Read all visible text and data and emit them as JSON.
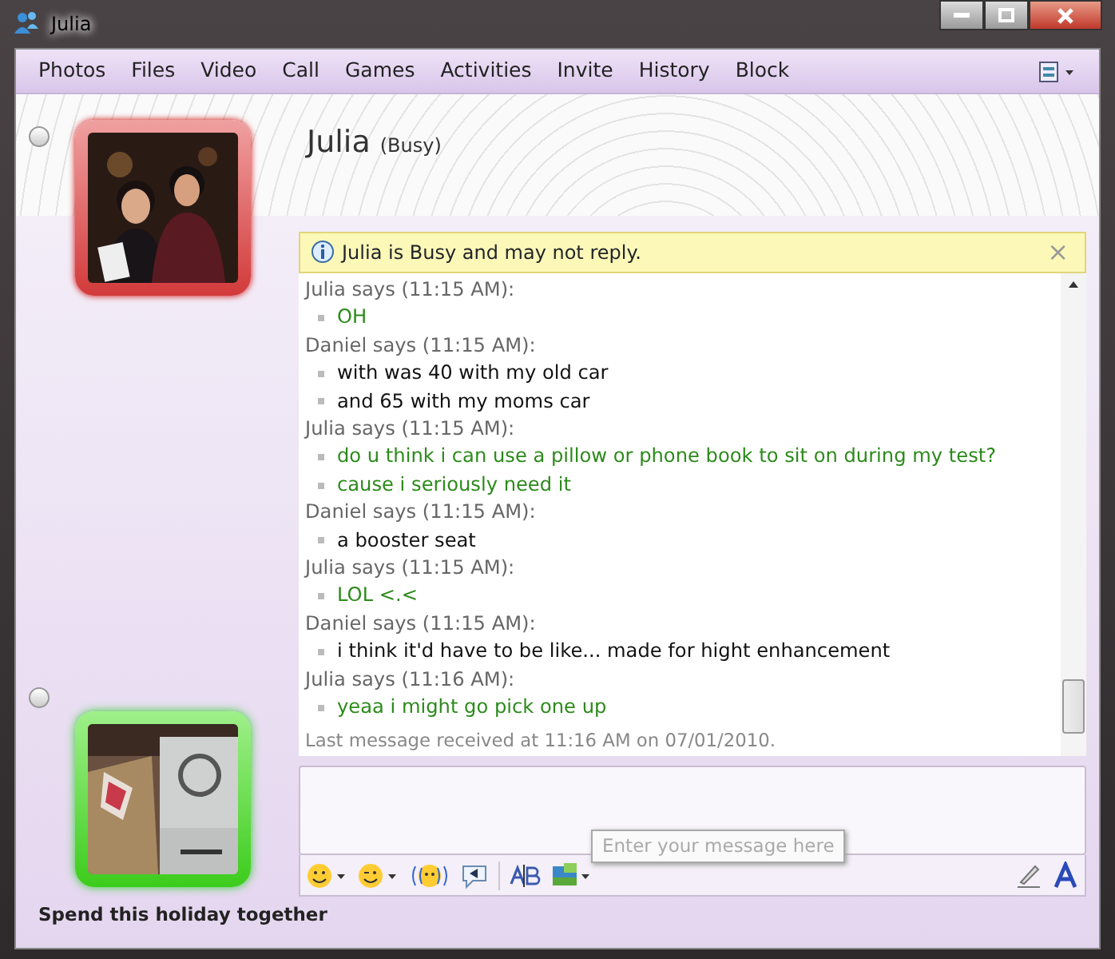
{
  "window": {
    "title": "Julia"
  },
  "menu": [
    "Photos",
    "Files",
    "Video",
    "Call",
    "Games",
    "Activities",
    "Invite",
    "History",
    "Block"
  ],
  "contact": {
    "name": "Julia",
    "status": "(Busy)"
  },
  "notice": {
    "text": "Julia is Busy and may not reply.",
    "close": "×"
  },
  "messages": [
    {
      "kind": "contact",
      "header": "Julia says (11:15 AM):",
      "lines": [
        "OH"
      ]
    },
    {
      "kind": "self",
      "header": "Daniel says (11:15 AM):",
      "lines": [
        "with was 40 with my old car",
        "and 65 with my moms car"
      ]
    },
    {
      "kind": "contact",
      "header": "Julia says (11:15 AM):",
      "lines": [
        "do u think i can use a pillow or phone book to sit on during my test?",
        "cause i seriously need it"
      ]
    },
    {
      "kind": "self",
      "header": "Daniel says (11:15 AM):",
      "lines": [
        "a booster seat"
      ]
    },
    {
      "kind": "contact",
      "header": "Julia says (11:15 AM):",
      "lines": [
        "LOL <.<"
      ]
    },
    {
      "kind": "self",
      "header": "Daniel says (11:15 AM):",
      "lines": [
        "i think it'd have to be like... made for hight enhancement"
      ]
    },
    {
      "kind": "contact",
      "header": "Julia says (11:16 AM):",
      "lines": [
        "yeaa i might go pick one up"
      ]
    }
  ],
  "last_message": "Last message received at 11:16 AM on 07/01/2010.",
  "tooltip": "Enter your message here",
  "footer": "Spend this holiday together"
}
